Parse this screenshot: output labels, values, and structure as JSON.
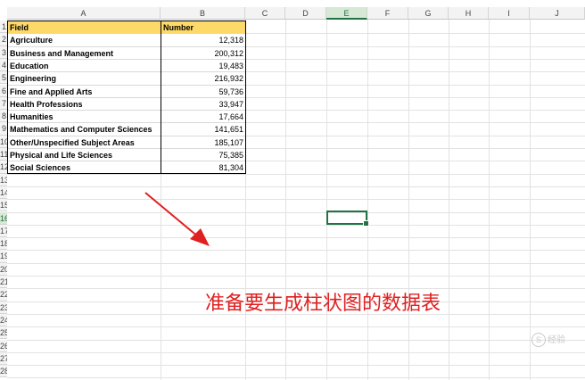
{
  "columns": [
    "A",
    "B",
    "C",
    "D",
    "E",
    "F",
    "G",
    "H",
    "I",
    "J"
  ],
  "row_numbers": [
    "1",
    "2",
    "3",
    "4",
    "5",
    "6",
    "7",
    "8",
    "9",
    "10",
    "11",
    "12",
    "13",
    "14",
    "15",
    "16",
    "17",
    "18",
    "19",
    "20",
    "21",
    "22",
    "23",
    "24",
    "25",
    "26",
    "27",
    "28"
  ],
  "table": {
    "headers": [
      "Field",
      "Number"
    ],
    "rows": [
      [
        "Agriculture",
        "12,318"
      ],
      [
        "Business and Management",
        "200,312"
      ],
      [
        "Education",
        "19,483"
      ],
      [
        "Engineering",
        "216,932"
      ],
      [
        "Fine and Applied Arts",
        "59,736"
      ],
      [
        "Health Professions",
        "33,947"
      ],
      [
        "Humanities",
        "17,664"
      ],
      [
        "Mathematics and Computer Sciences",
        "141,651"
      ],
      [
        "Other/Unspecified Subject Areas",
        "185,107"
      ],
      [
        "Physical and Life Sciences",
        "75,385"
      ],
      [
        "Social Sciences",
        "81,304"
      ]
    ]
  },
  "active_cell": "E16",
  "caption": "准备要生成柱状图的数据表",
  "watermark": "经验",
  "colors": {
    "header_fill": "#fdd969",
    "selection": "#217346",
    "annotation": "#e02020"
  }
}
